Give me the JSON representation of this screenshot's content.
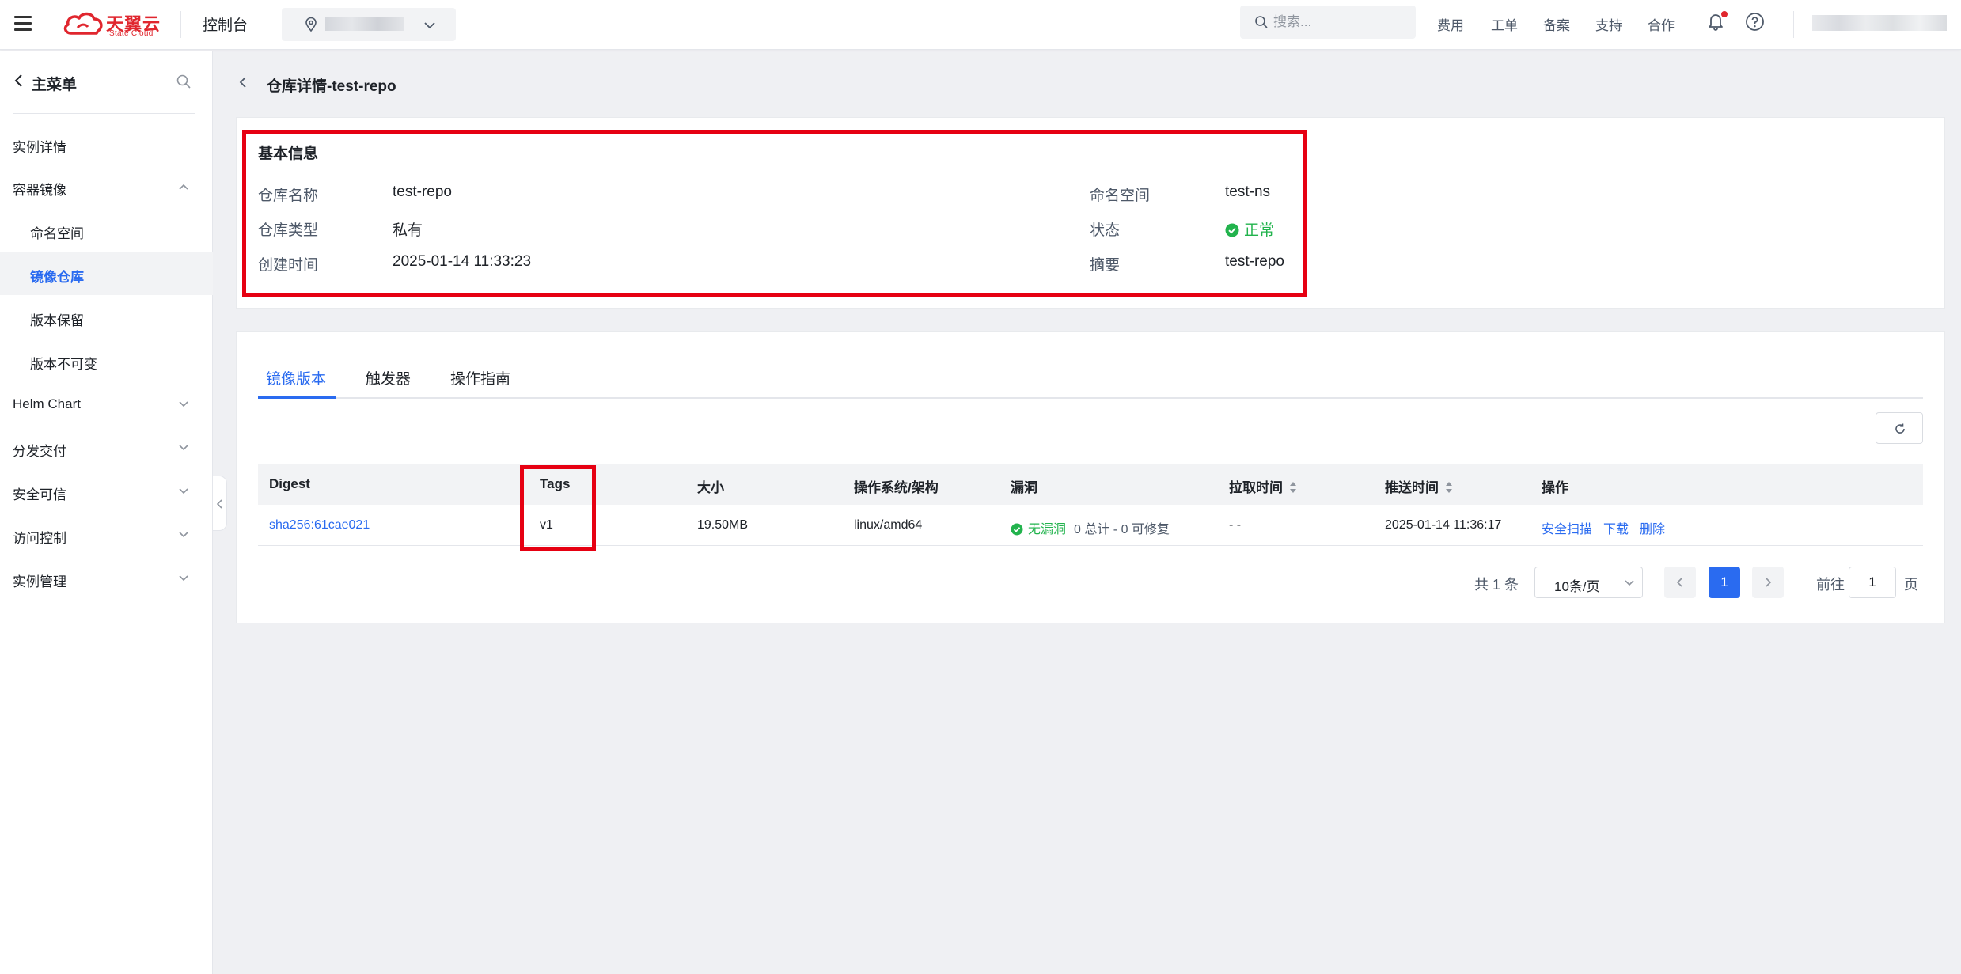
{
  "header": {
    "logo_cn": "天翼云",
    "logo_en": "State Cloud",
    "console_title": "控制台",
    "search_placeholder": "搜索...",
    "links": [
      "费用",
      "工单",
      "备案",
      "支持",
      "合作"
    ]
  },
  "sidebar": {
    "title": "主菜单",
    "items": [
      {
        "label": "实例详情"
      },
      {
        "label": "容器镜像"
      },
      {
        "label": "命名空间"
      },
      {
        "label": "镜像仓库"
      },
      {
        "label": "版本保留"
      },
      {
        "label": "版本不可变"
      },
      {
        "label": "Helm Chart"
      },
      {
        "label": "分发交付"
      },
      {
        "label": "安全可信"
      },
      {
        "label": "访问控制"
      },
      {
        "label": "实例管理"
      }
    ]
  },
  "page": {
    "title": "仓库详情-test-repo"
  },
  "basic_info": {
    "title": "基本信息",
    "fields": [
      {
        "label": "仓库名称",
        "value": "test-repo"
      },
      {
        "label": "仓库类型",
        "value": "私有"
      },
      {
        "label": "创建时间",
        "value": "2025-01-14 11:33:23"
      },
      {
        "label": "命名空间",
        "value": "test-ns"
      },
      {
        "label": "状态",
        "value": "正常"
      },
      {
        "label": "摘要",
        "value": "test-repo"
      }
    ]
  },
  "tabs": [
    "镜像版本",
    "触发器",
    "操作指南"
  ],
  "table": {
    "columns": [
      "Digest",
      "Tags",
      "大小",
      "操作系统/架构",
      "漏洞",
      "拉取时间",
      "推送时间",
      "操作"
    ],
    "rows": [
      {
        "digest": "sha256:61cae021",
        "tags": "v1",
        "size": "19.50MB",
        "os_arch": "linux/amd64",
        "vuln_status": "无漏洞",
        "vuln_detail": "0 总计 - 0 可修复",
        "pull_time": "- -",
        "push_time": "2025-01-14 11:36:17",
        "actions": [
          "安全扫描",
          "下载",
          "删除"
        ]
      }
    ]
  },
  "pagination": {
    "total_text": "共 1 条",
    "page_size": "10条/页",
    "current_page": "1",
    "goto_label": "前往",
    "goto_value": "1",
    "goto_suffix": "页"
  },
  "colors": {
    "accent": "#2a6bf0",
    "brand": "#e0262e",
    "success": "#22b34d",
    "highlight": "#e60012"
  }
}
